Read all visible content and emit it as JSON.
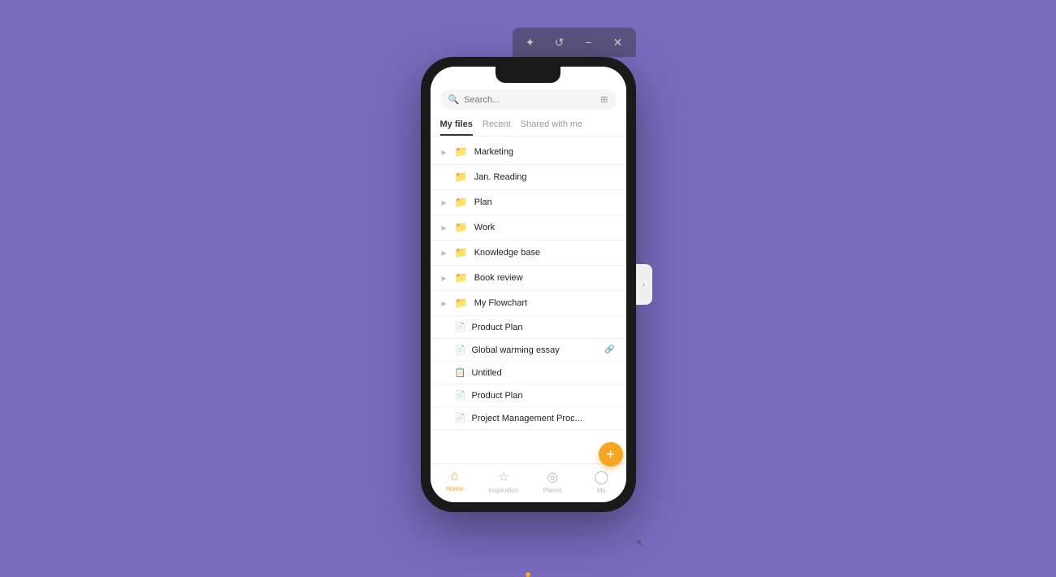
{
  "background": "#7b6bbf",
  "titleBar": {
    "buttons": [
      {
        "name": "sparkle",
        "icon": "✦"
      },
      {
        "name": "history",
        "icon": "↺"
      },
      {
        "name": "minimize",
        "icon": "−"
      },
      {
        "name": "close",
        "icon": "✕"
      }
    ]
  },
  "search": {
    "placeholder": "Search..."
  },
  "tabs": [
    {
      "label": "My files",
      "active": true
    },
    {
      "label": "Recent",
      "active": false
    },
    {
      "label": "Shared with me",
      "active": false
    }
  ],
  "files": [
    {
      "type": "folder",
      "name": "Marketing",
      "expandable": true
    },
    {
      "type": "folder",
      "name": "Jan. Reading",
      "expandable": false
    },
    {
      "type": "folder",
      "name": "Plan",
      "expandable": true
    },
    {
      "type": "folder",
      "name": "Work",
      "expandable": true
    },
    {
      "type": "folder",
      "name": "Knowledge base",
      "expandable": true
    },
    {
      "type": "folder",
      "name": "Book review",
      "expandable": true
    },
    {
      "type": "folder",
      "name": "My Flowchart",
      "expandable": true
    },
    {
      "type": "doc",
      "name": "Product Plan",
      "shared": false
    },
    {
      "type": "doc",
      "name": "Global warming essay",
      "shared": true
    },
    {
      "type": "doc",
      "name": "Untitled",
      "shared": false,
      "blue": true
    },
    {
      "type": "doc",
      "name": "Product Plan",
      "shared": false
    },
    {
      "type": "doc",
      "name": "Project Management Proc...",
      "shared": false
    }
  ],
  "bottomNav": [
    {
      "label": "Home",
      "icon": "⌂",
      "active": true
    },
    {
      "label": "Inspiration",
      "icon": "☆",
      "active": false
    },
    {
      "label": "Planet",
      "icon": "◎",
      "active": false
    },
    {
      "label": "My",
      "icon": "◯",
      "active": false
    }
  ],
  "fab": {
    "icon": "+"
  }
}
